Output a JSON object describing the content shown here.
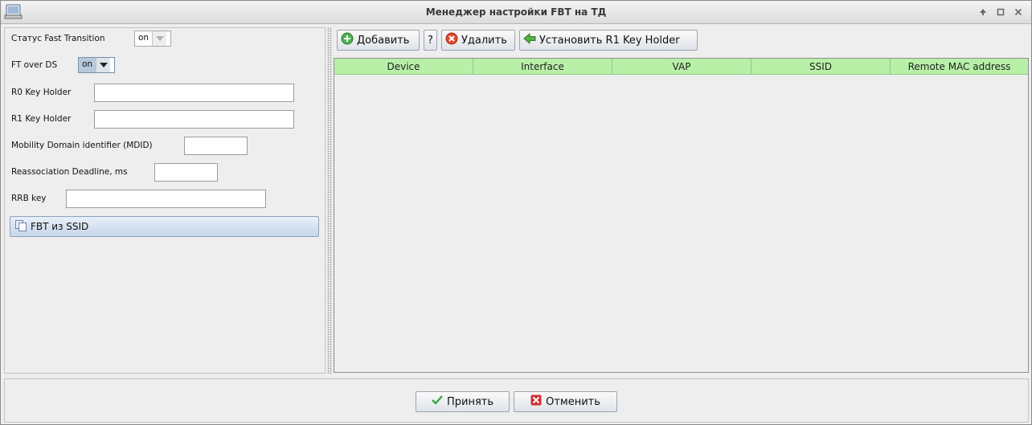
{
  "window": {
    "title": "Менеджер настройки FBT на ТД"
  },
  "form": {
    "ft_status_label": "Статус Fast Transition",
    "ft_status_value": "on",
    "ft_over_ds_label": "FT over DS",
    "ft_over_ds_value": "on",
    "r0_label": "R0 Key Holder",
    "r0_value": "",
    "r1_label": "R1 Key Holder",
    "r1_value": "",
    "mdid_label": "Mobility Domain identifier (MDID)",
    "mdid_value": "",
    "reassoc_label": "Reassociation Deadline, ms",
    "reassoc_value": "",
    "rrb_label": "RRB key",
    "rrb_value": "",
    "fbt_ssid_button": "FBT из SSID"
  },
  "toolbar": {
    "add_label": "Добавить",
    "help_label": "?",
    "delete_label": "Удалить",
    "set_r1_label": "Установить R1 Key Holder"
  },
  "table": {
    "columns": [
      "Device",
      "Interface",
      "VAP",
      "SSID",
      "Remote MAC address"
    ],
    "rows": []
  },
  "footer": {
    "accept_label": "Принять",
    "cancel_label": "Отменить"
  },
  "colors": {
    "header_green": "#b8f0a8",
    "accept_check": "#3aa53a",
    "cancel_x": "#d03030"
  }
}
